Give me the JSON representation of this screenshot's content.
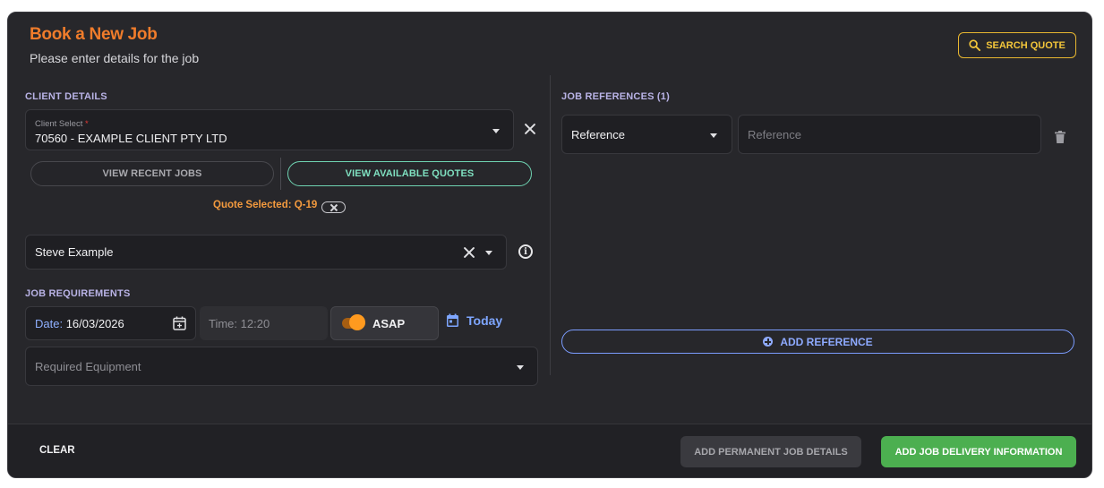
{
  "header": {
    "title": "Book a New Job",
    "subtitle": "Please enter details for the job",
    "search_quote_label": "SEARCH QUOTE"
  },
  "client_details": {
    "section_label": "CLIENT DETAILS",
    "client_select_label": "Client Select",
    "client_select_required": "*",
    "client_select_value": "70560 - EXAMPLE CLIENT PTY LTD",
    "view_recent_jobs_label": "VIEW RECENT JOBS",
    "view_available_quotes_label": "VIEW AVAILABLE QUOTES",
    "quote_selected_text": "Quote Selected: Q-19",
    "contact_value": "Steve Example"
  },
  "job_requirements": {
    "section_label": "JOB REQUIREMENTS",
    "date_label": "Date:",
    "date_value": "16/03/2026",
    "time_label": "Time:",
    "time_value": "12:20",
    "asap_label": "ASAP",
    "asap_on": true,
    "today_label": "Today",
    "equipment_placeholder": "Required Equipment"
  },
  "job_references": {
    "section_label": "JOB REFERENCES (1)",
    "rows": [
      {
        "type_value": "Reference",
        "input_placeholder": "Reference"
      }
    ],
    "add_reference_label": "ADD REFERENCE"
  },
  "footer": {
    "clear_label": "CLEAR",
    "add_permanent_label": "ADD PERMANENT JOB DETAILS",
    "add_delivery_label": "ADD JOB DELIVERY INFORMATION"
  },
  "colors": {
    "accent_orange": "#f07c2b",
    "accent_yellow": "#f3c63a",
    "accent_teal": "#7fe0c0",
    "accent_blue": "#8eaaff",
    "success_green": "#4caf50",
    "card_bg": "#27272b"
  },
  "icons": {
    "search": "search-icon",
    "clear": "close-icon",
    "dropdown": "chevron-down-icon",
    "info": "info-icon",
    "calendar": "calendar-icon",
    "delete": "trash-icon",
    "add": "plus-circle-icon"
  }
}
